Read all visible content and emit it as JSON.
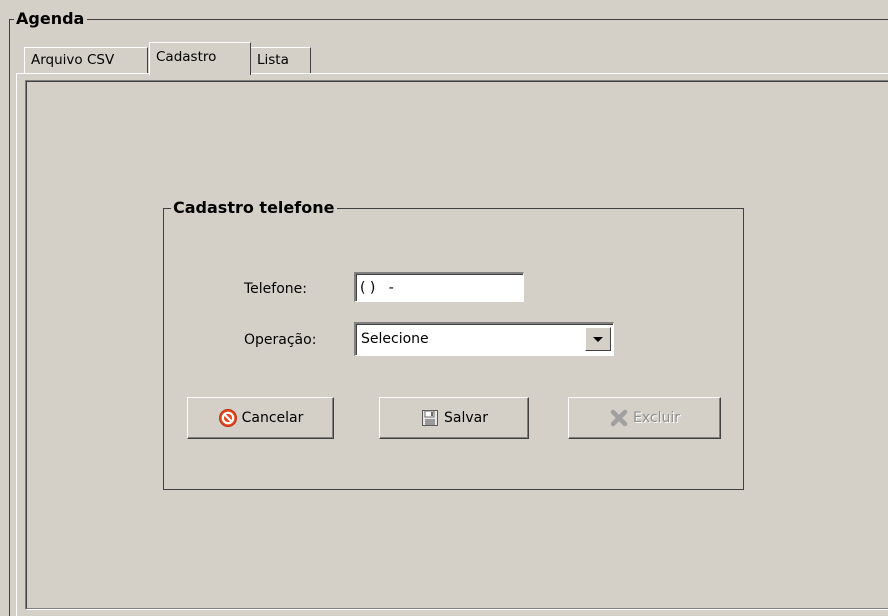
{
  "agenda": {
    "title": "Agenda",
    "tabs": [
      {
        "label": "Arquivo CSV",
        "active": false
      },
      {
        "label": "Cadastro",
        "active": true
      },
      {
        "label": "Lista",
        "active": false
      }
    ]
  },
  "cadastro": {
    "group_title": "Cadastro telefone",
    "telefone": {
      "label": "Telefone:",
      "value": "( )   -"
    },
    "operacao": {
      "label": "Operação:",
      "selected": "Selecione"
    },
    "buttons": {
      "cancel": {
        "label": "Cancelar",
        "icon": "cancel-icon",
        "enabled": true
      },
      "save": {
        "label": "Salvar",
        "icon": "floppy-disk-icon",
        "enabled": true
      },
      "delete": {
        "label": "Excluir",
        "icon": "delete-x-icon",
        "enabled": false
      }
    }
  },
  "colors": {
    "window_bg": "#d4d0c8",
    "cancel_icon": "#e8491d",
    "delete_icon_disabled": "#a0a0a0"
  }
}
